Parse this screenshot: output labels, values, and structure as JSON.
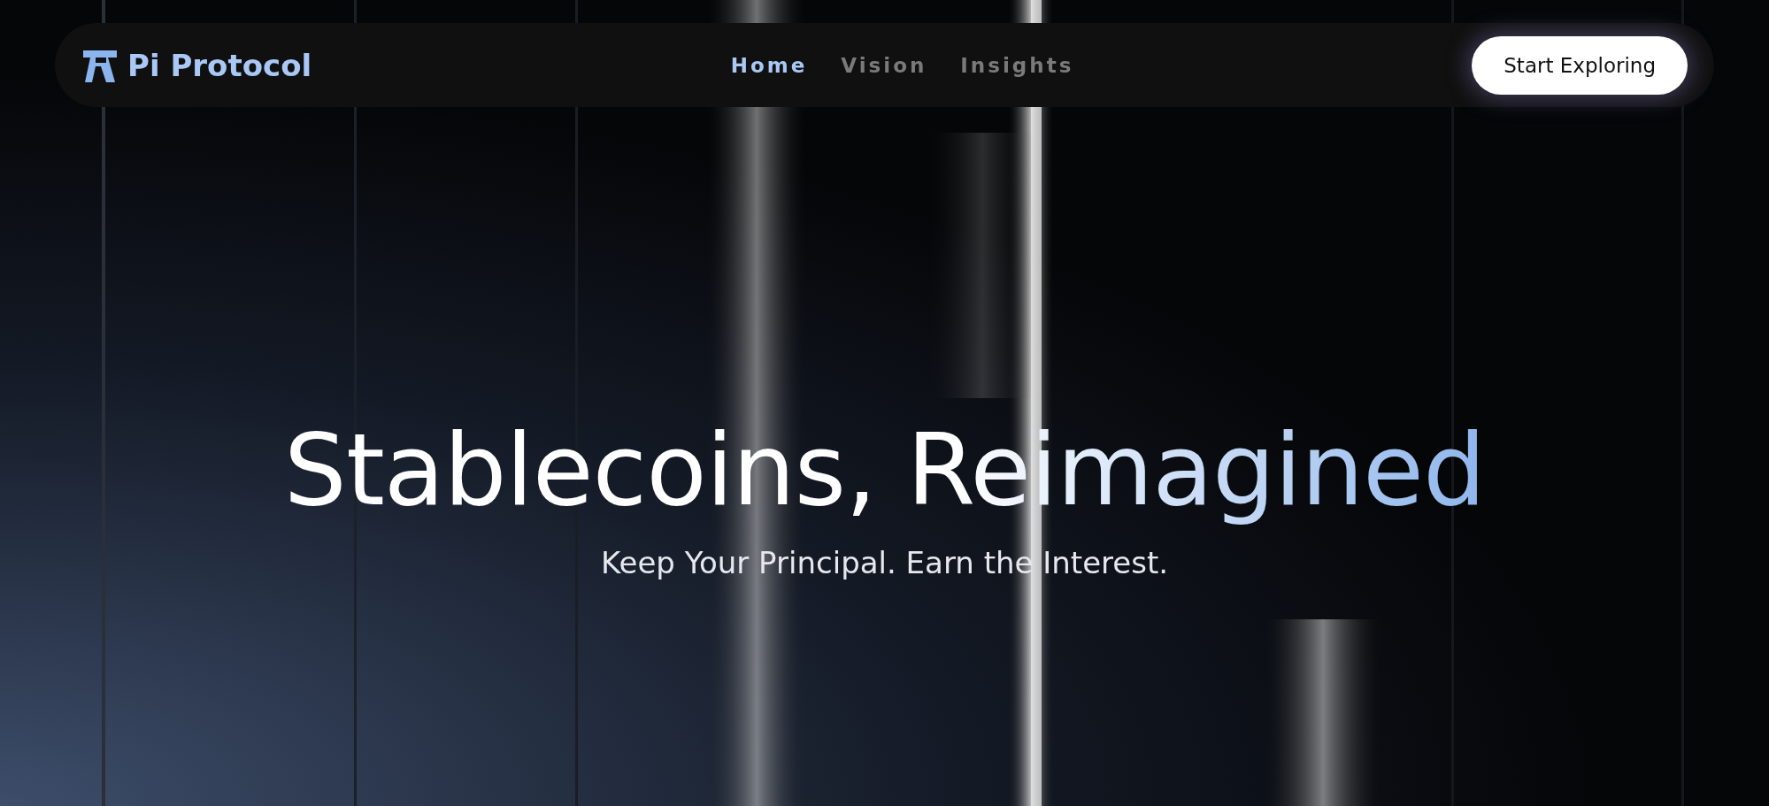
{
  "nav": {
    "brand": "Pi Protocol",
    "links": [
      {
        "label": "Home",
        "selected": true
      },
      {
        "label": "Vision",
        "selected": false
      },
      {
        "label": "Insights",
        "selected": false
      }
    ],
    "cta": "Start Exploring"
  },
  "hero": {
    "title": "Stablecoins, Reimagined",
    "subtitle": "Keep Your Principal. Earn the Interest."
  }
}
